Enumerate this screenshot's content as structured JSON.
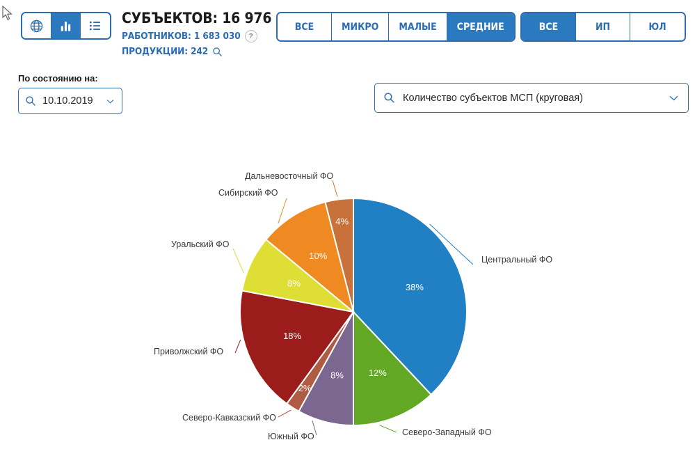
{
  "header": {
    "view_modes": [
      {
        "name": "map-view",
        "icon": "globe-icon",
        "active": false
      },
      {
        "name": "chart-view",
        "icon": "bar-chart-icon",
        "active": true
      },
      {
        "name": "list-view",
        "icon": "list-icon",
        "active": false
      }
    ],
    "stats": {
      "subjects_line": "СУБЪЕКТОВ: 16 976",
      "workers_line": "РАБОТНИКОВ: 1 683 030",
      "products_line": "ПРОДУКЦИИ: 242",
      "help_badge": "?",
      "search_icon": "search-icon"
    },
    "size_filter": {
      "name": "size-filter",
      "options": [
        {
          "label": "ВСЕ",
          "active": false
        },
        {
          "label": "МИКРО",
          "active": false
        },
        {
          "label": "МАЛЫЕ",
          "active": false
        },
        {
          "label": "СРЕДНИЕ",
          "active": true
        }
      ]
    },
    "form_filter": {
      "name": "form-filter",
      "options": [
        {
          "label": "ВСЕ",
          "active": true
        },
        {
          "label": "ИП",
          "active": false
        },
        {
          "label": "ЮЛ",
          "active": false
        }
      ]
    }
  },
  "controls": {
    "date": {
      "label": "По состоянию на:",
      "value": "10.10.2019",
      "search_icon": "search-icon",
      "chevron_icon": "chevron-down-icon"
    },
    "metric": {
      "value": "Количество субъектов МСП (круговая)",
      "search_icon": "search-icon",
      "chevron_icon": "chevron-down-icon"
    }
  },
  "colors": {
    "brand_blue": "#2b6cb3",
    "active_blue": "#2b7abf",
    "text_dark": "#1b1b1b"
  },
  "chart_data": {
    "type": "pie",
    "title": "Количество субъектов МСП (круговая)",
    "unit": "%",
    "legend": "labels-with-leader-lines",
    "grid": false,
    "categories": [
      "Центральный ФО",
      "Северо-Западный ФО",
      "Южный ФО",
      "Северо-Кавказский ФО",
      "Приволжский ФО",
      "Уральский ФО",
      "Сибирский ФО",
      "Дальневосточный ФО"
    ],
    "values": [
      38,
      12,
      8,
      2,
      18,
      8,
      10,
      4
    ],
    "value_labels": [
      "38%",
      "12%",
      "8%",
      "2%",
      "18%",
      "8%",
      "10%",
      "4%"
    ],
    "colors": [
      "#2180c4",
      "#62a825",
      "#7c6790",
      "#b05c44",
      "#9c1c1c",
      "#dede35",
      "#ef8a22",
      "#c9713a"
    ]
  }
}
